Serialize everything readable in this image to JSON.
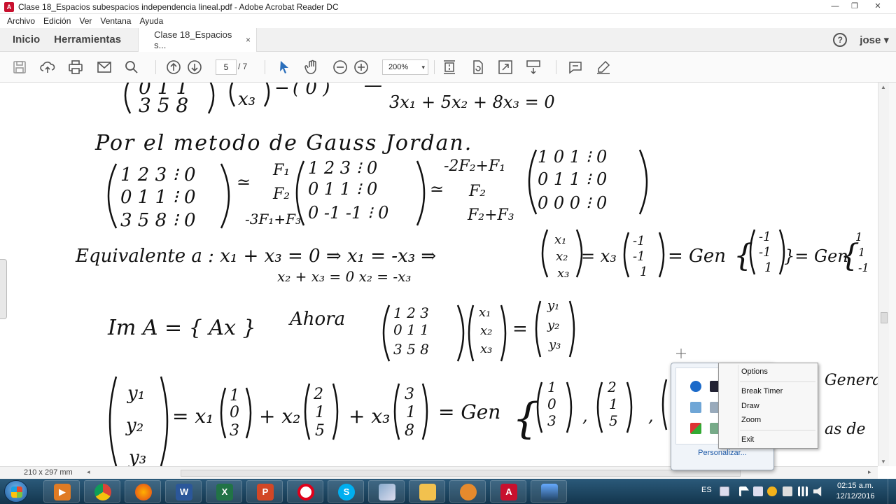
{
  "window": {
    "title": "Clase 18_Espacios subespacios independencia lineal.pdf - Adobe Acrobat Reader DC",
    "controls": [
      "minimize",
      "maximize",
      "close"
    ]
  },
  "menubar": [
    "Archivo",
    "Edición",
    "Ver",
    "Ventana",
    "Ayuda"
  ],
  "tabbar": {
    "home": "Inicio",
    "tools": "Herramientas",
    "doc_tab": "Clase 18_Espacios s...",
    "doc_tab_close": "×",
    "help": "?",
    "user": "jose",
    "user_caret": "▾"
  },
  "toolbar": {
    "page_current": "5",
    "page_total": "/ 7",
    "zoom": "200%",
    "zoom_caret": "▾",
    "icons": [
      "save-icon",
      "upload-icon",
      "print-icon",
      "mail-icon",
      "search-icon",
      "prev-page-icon",
      "next-page-icon",
      "select-cursor-icon",
      "hand-tool-icon",
      "zoom-out-icon",
      "zoom-in-icon",
      "fit-page-icon",
      "rotate-icon",
      "full-screen-icon",
      "scroll-mode-icon",
      "comment-icon",
      "sign-icon"
    ]
  },
  "document": {
    "line1_left": "0  1  1",
    "line1_left2": "3  5  8",
    "line1_x": "x₃",
    "line1_eq": "3x₁ + 5x₂ + 8x₃ = 0",
    "heading": "Por el metodo de Gauss Jordan.",
    "m1": [
      "1 2 3 ⁝ 0",
      "0 1 1 ⁝ 0",
      "3 5 8 ⁝ 0"
    ],
    "ops1": [
      "F₁",
      "F₂",
      "-3F₁+F₃"
    ],
    "m2": [
      "1 2 3 ⁝ 0",
      "0 1 1 ⁝ 0",
      "0 -1 -1 ⁝ 0"
    ],
    "ops2": [
      "-2F₂+F₁",
      "F₂",
      "F₂+F₃"
    ],
    "m3": [
      "1 0 1 ⁝ 0",
      "0 1 1 ⁝ 0",
      "0 0 0 ⁝ 0"
    ],
    "equiv": "Equivalente a : x₁   + x₃ = 0  ⇒  x₁ = -x₃  ⇒",
    "equiv2": "x₂ + x₃ = 0          x₂ = -x₃",
    "vec_x": [
      "x₁",
      "x₂",
      "x₃"
    ],
    "eq_gen": "= x₃",
    "vec_neg": [
      "-1",
      "-1",
      "1"
    ],
    "gen": "= Gen",
    "gen2": "}= Gen",
    "vec_tail": [
      "1",
      "1",
      "-1"
    ],
    "im": "Im A = { Ax }",
    "ahora": "Ahora",
    "mA": [
      "1 2 3",
      "0 1 1",
      "3 5 8"
    ],
    "vec_y": [
      "y₁",
      "y₂",
      "y₃"
    ],
    "lincomb": "= x₁",
    "c1": [
      "1",
      "0",
      "3"
    ],
    "plus_x2": "+ x₂",
    "c2": [
      "2",
      "1",
      "5"
    ],
    "plus_x3": "+ x₃",
    "c3": [
      "3",
      "1",
      "8"
    ],
    "eq_gen3": "= Gen",
    "right_text": [
      "Genera",
      "as de"
    ]
  },
  "statusbar": {
    "page_size": "210 x 297 mm"
  },
  "taskbar": {
    "apps": [
      "media-player",
      "chrome",
      "firefox",
      "word",
      "excel",
      "powerpoint",
      "opera",
      "skype",
      "paint",
      "explorer",
      "presenter",
      "acrobat",
      "screen-capture"
    ],
    "language": "ES",
    "time": "02:15 a.m.",
    "date": "12/12/2016"
  },
  "tray_popup": {
    "customize": "Personalizar..."
  },
  "context_menu": {
    "items": [
      "Options",
      "Break Timer",
      "Draw",
      "Zoom",
      "Exit"
    ]
  },
  "colors": {
    "taskbar": "#1f4a66",
    "acrobat_red": "#c8102e",
    "ink": "#111111"
  }
}
